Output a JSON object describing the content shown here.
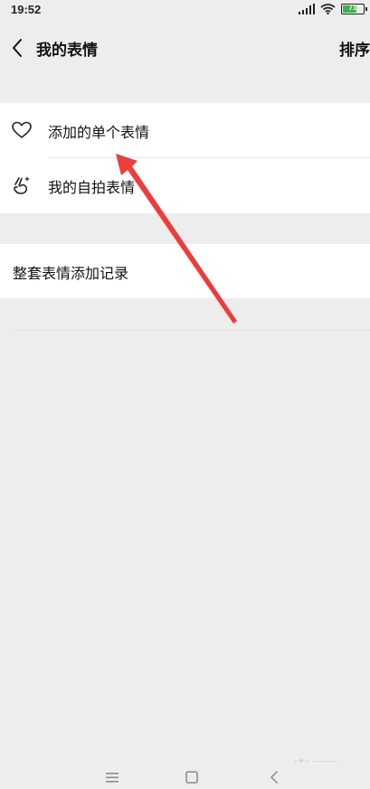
{
  "status_bar": {
    "time": "19:52",
    "battery": "71",
    "battery_level": 0.71
  },
  "nav_bar": {
    "title": "我的表情",
    "action": "排序"
  },
  "list": {
    "group1": [
      {
        "label": "添加的单个表情",
        "icon": "heart-icon"
      },
      {
        "label": "我的自拍表情",
        "icon": "selfie-hand-icon"
      }
    ],
    "group2": [
      {
        "label": "整套表情添加记录"
      }
    ]
  },
  "colors": {
    "background": "#ededed",
    "cell": "#ffffff",
    "battery": "#3bb34a",
    "annotation_arrow": "#ee3b3b"
  }
}
